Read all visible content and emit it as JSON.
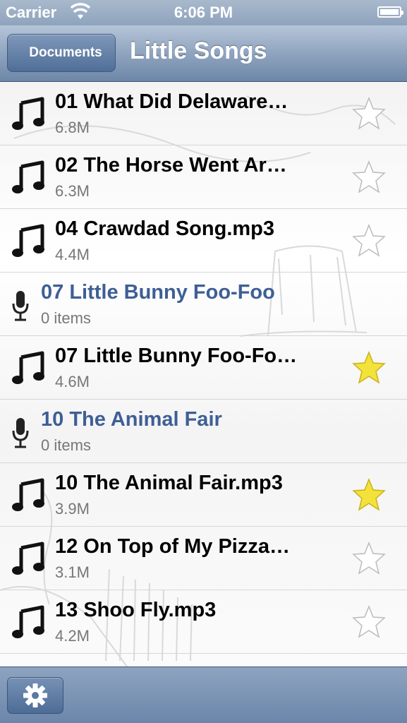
{
  "status": {
    "carrier": "Carrier",
    "time": "6:06 PM"
  },
  "nav": {
    "back_label": "Documents",
    "title": "Little Songs"
  },
  "rows": [
    {
      "kind": "song",
      "title": "01 What Did Delaware…",
      "sub": "6.8M",
      "starred": false
    },
    {
      "kind": "song",
      "title": "02 The Horse Went Ar…",
      "sub": "6.3M",
      "starred": false
    },
    {
      "kind": "song",
      "title": "04 Crawdad Song.mp3",
      "sub": "4.4M",
      "starred": false
    },
    {
      "kind": "folder",
      "title": "07 Little Bunny Foo-Foo",
      "sub": "0 items"
    },
    {
      "kind": "song",
      "title": "07 Little Bunny Foo-Fo…",
      "sub": "4.6M",
      "starred": true
    },
    {
      "kind": "folder",
      "title": "10 The Animal Fair",
      "sub": "0 items"
    },
    {
      "kind": "song",
      "title": "10 The Animal Fair.mp3",
      "sub": "3.9M",
      "starred": true
    },
    {
      "kind": "song",
      "title": "12 On Top of My Pizza…",
      "sub": "3.1M",
      "starred": false
    },
    {
      "kind": "song",
      "title": "13 Shoo Fly.mp3",
      "sub": "4.2M",
      "starred": false
    }
  ],
  "icons": {
    "song": "music-note-icon",
    "folder": "microphone-icon",
    "settings": "gear-icon"
  },
  "colors": {
    "folder_title": "#3e5f95",
    "star_filled": "#f3e23a",
    "bar": "#7f98ba"
  }
}
